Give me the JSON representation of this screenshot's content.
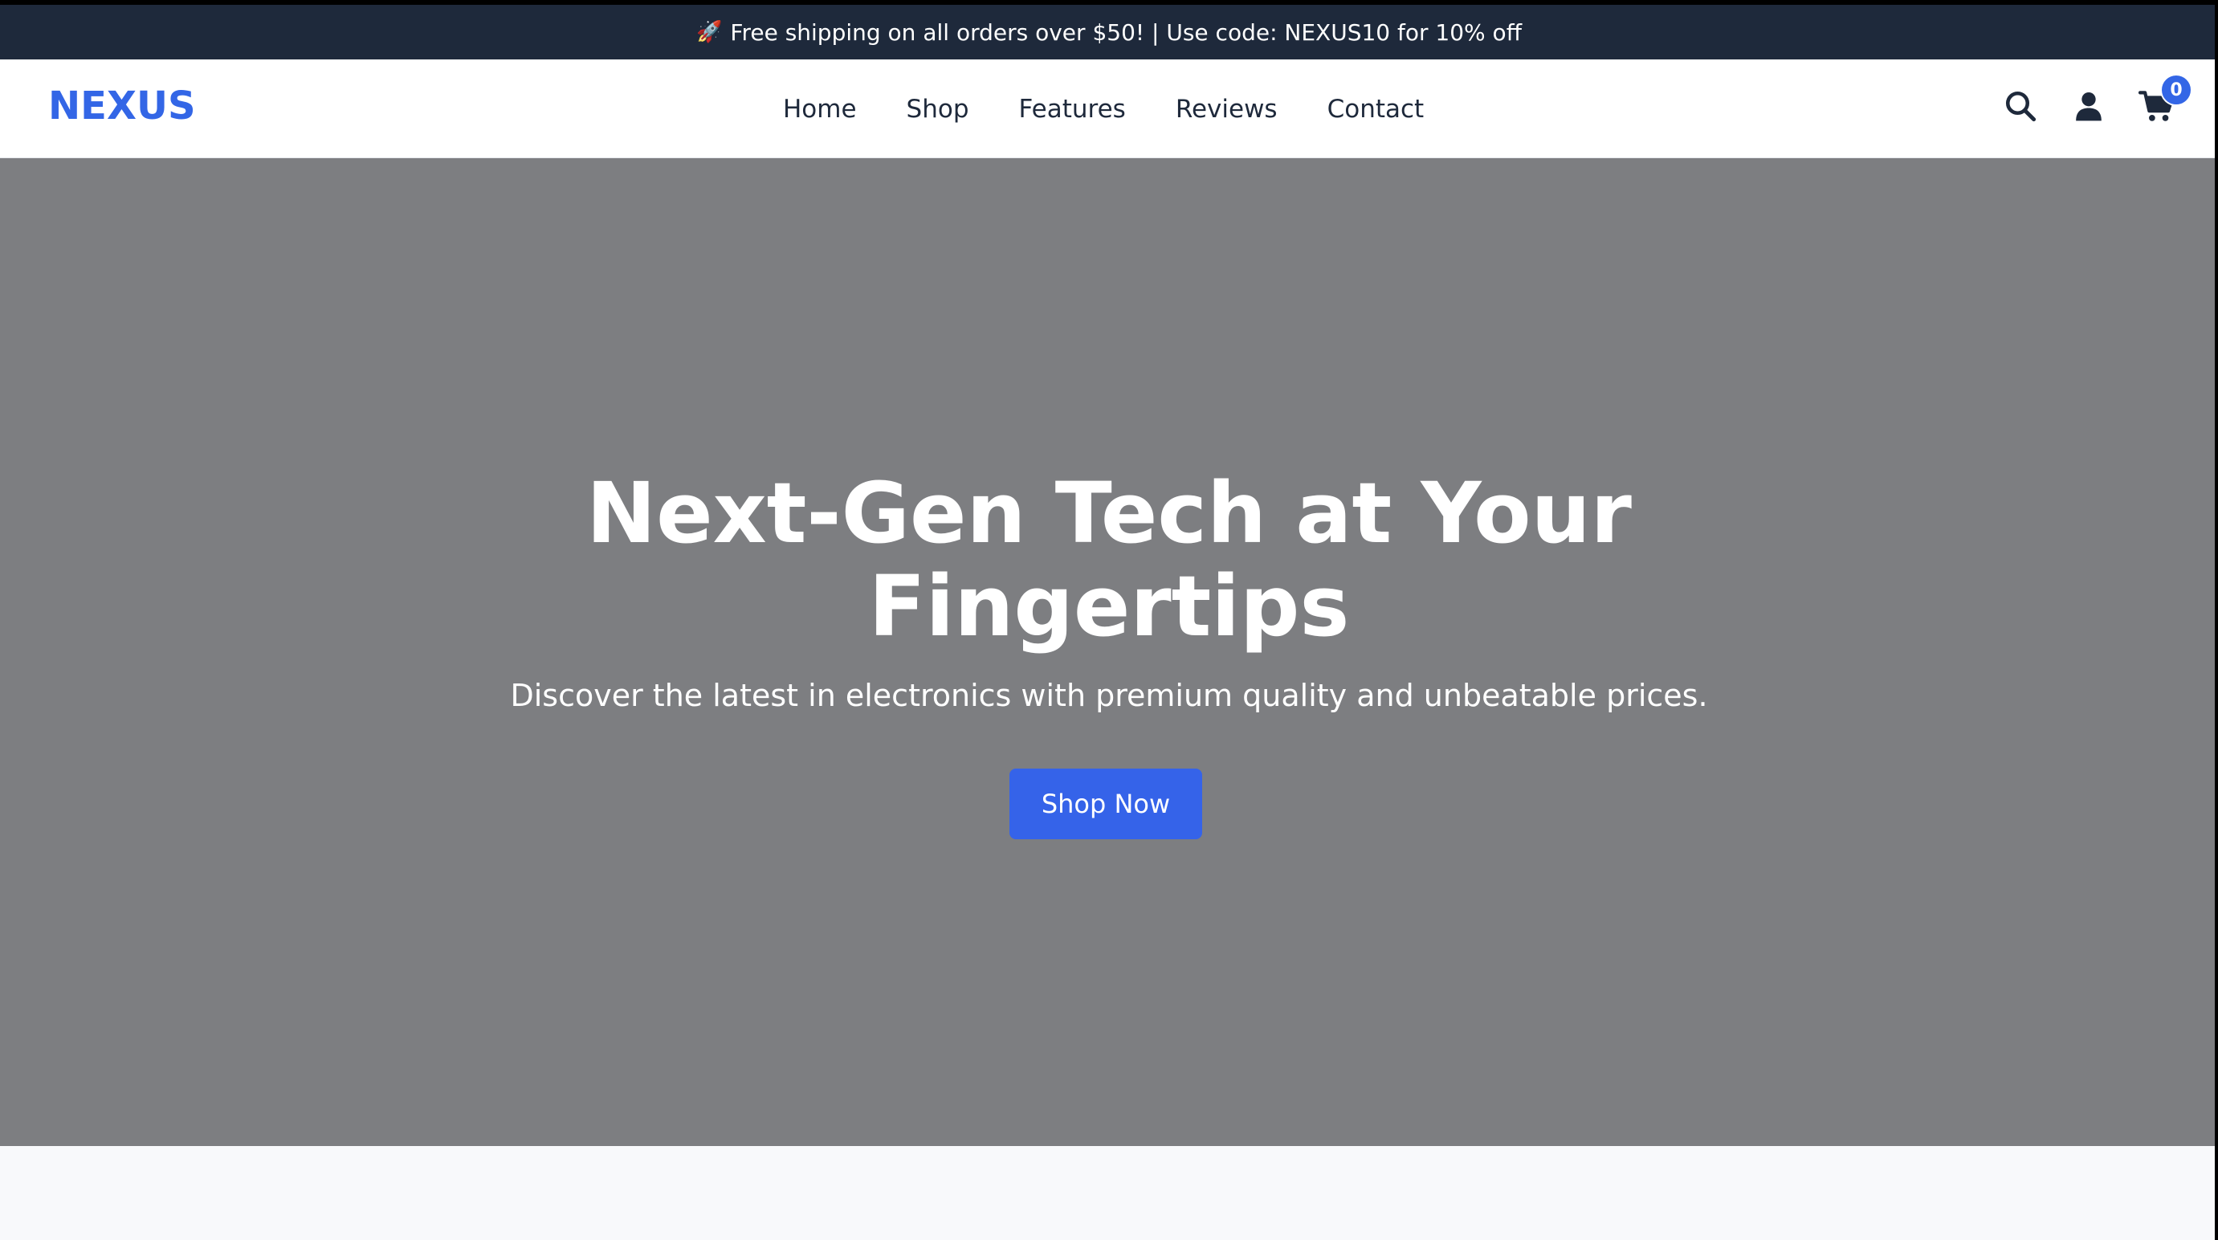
{
  "promo": {
    "icon": "rocket-icon",
    "text": "Free shipping on all orders over $50! | Use code: NEXUS10 for 10% off"
  },
  "navbar": {
    "logo": "NEXUS",
    "links": [
      {
        "label": "Home"
      },
      {
        "label": "Shop"
      },
      {
        "label": "Features"
      },
      {
        "label": "Reviews"
      },
      {
        "label": "Contact"
      }
    ],
    "icons": {
      "search": "search-icon",
      "account": "user-icon",
      "cart": "cart-icon"
    },
    "cart_count": "0"
  },
  "hero": {
    "title_line1": "Next-Gen Tech at Your",
    "title_line2": "Fingertips",
    "subtitle": "Discover the latest in electronics with premium quality and unbeatable prices.",
    "cta_label": "Shop Now"
  },
  "colors": {
    "promo_bg": "#1e293b",
    "brand": "#3366e6",
    "hero_bg": "#7d7e81",
    "cta_bg": "#3563e9",
    "nav_text": "#1e293b",
    "page_bg": "#f8f9fb"
  }
}
